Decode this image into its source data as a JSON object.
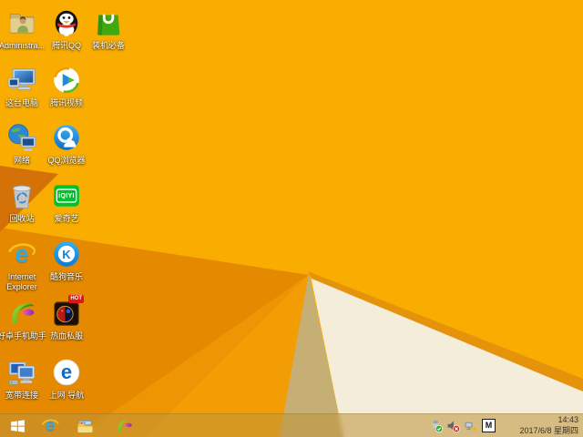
{
  "wallpaper": {
    "colors": {
      "base": "#F8AD00",
      "fold_left_dark": "#E58A00",
      "fold_left_mid": "#ED9503",
      "fold_left_light": "#F29D04",
      "notch_dark": "#D47208",
      "shadow_tan": "#C6AF75",
      "fold_white": "#F3EDDA",
      "fold_edge": "#E6930C"
    }
  },
  "desktop": {
    "icons": [
      {
        "id": "administrator",
        "label": "Administra..."
      },
      {
        "id": "tencent-qq",
        "label": "腾讯QQ"
      },
      {
        "id": "zhuangji-bibei",
        "label": "装机必备"
      },
      {
        "id": "this-pc",
        "label": "这台电脑"
      },
      {
        "id": "tencent-video",
        "label": "腾讯视频"
      },
      {
        "id": "network",
        "label": "网络"
      },
      {
        "id": "qq-browser",
        "label": "QQ浏览器"
      },
      {
        "id": "recycle-bin",
        "label": "回收站"
      },
      {
        "id": "iqiyi",
        "label": "爱奇艺",
        "monogram": "iQIYI"
      },
      {
        "id": "internet-explorer",
        "label": "Internet Explorer",
        "monogram": "e"
      },
      {
        "id": "kugou-music",
        "label": "酷狗音乐",
        "monogram": "K"
      },
      {
        "id": "haozhuo-assistant",
        "label": "好卓手机助手"
      },
      {
        "id": "rexue-sifu",
        "label": "热血私服",
        "badge": "HOT"
      },
      {
        "id": "broadband",
        "label": "宽带连接"
      },
      {
        "id": "shangwang-daohang",
        "label": "上网 导航",
        "monogram": "e"
      }
    ]
  },
  "taskbar": {
    "ie_monogram": "e",
    "ime_label": "M",
    "clock": {
      "time": "14:43",
      "date": "2017/6/8 星期四"
    }
  }
}
